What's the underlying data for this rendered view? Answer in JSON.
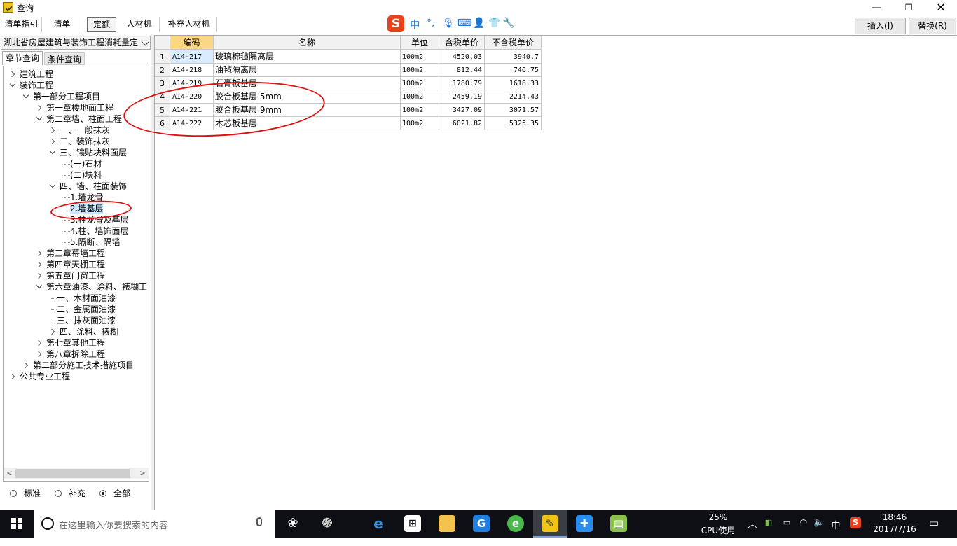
{
  "window": {
    "title": "查询"
  },
  "top_tabs": [
    "清单指引",
    "清单",
    "定额",
    "人材机",
    "补充人材机"
  ],
  "active_top_tab": "定额",
  "buttons": {
    "insert": "插入(I)",
    "replace": "替换(R)"
  },
  "ime": {
    "mode": "中",
    "punct": "°,"
  },
  "left_panel": {
    "dictionary": "湖北省房屋建筑与装饰工程消耗量定",
    "tabs": [
      "章节查询",
      "条件查询"
    ],
    "active_tab": "章节查询",
    "tree": [
      {
        "label": "建筑工程",
        "level": 0,
        "state": "collapsed"
      },
      {
        "label": "装饰工程",
        "level": 0,
        "state": "expanded"
      },
      {
        "label": "第一部分工程项目",
        "level": 1,
        "state": "expanded"
      },
      {
        "label": "第一章楼地面工程",
        "level": 2,
        "state": "collapsed"
      },
      {
        "label": "第二章墙、柱面工程",
        "level": 2,
        "state": "expanded"
      },
      {
        "label": "一、一般抹灰",
        "level": 3,
        "state": "collapsed"
      },
      {
        "label": "二、装饰抹灰",
        "level": 3,
        "state": "collapsed"
      },
      {
        "label": "三、镶贴块料面层",
        "level": 3,
        "state": "expanded"
      },
      {
        "label": "(一)石材",
        "level": 4,
        "state": "leaf"
      },
      {
        "label": "(二)块料",
        "level": 4,
        "state": "leaf"
      },
      {
        "label": "四、墙、柱面装饰",
        "level": 3,
        "state": "expanded"
      },
      {
        "label": "1.墙龙骨",
        "level": 4,
        "state": "leaf"
      },
      {
        "label": "2.墙基层",
        "level": 4,
        "state": "leaf",
        "selected": true
      },
      {
        "label": "3.柱龙骨及基层",
        "level": 4,
        "state": "leaf"
      },
      {
        "label": "4.柱、墙饰面层",
        "level": 4,
        "state": "leaf"
      },
      {
        "label": "5.隔断、隔墙",
        "level": 4,
        "state": "leaf"
      },
      {
        "label": "第三章幕墙工程",
        "level": 2,
        "state": "collapsed"
      },
      {
        "label": "第四章天棚工程",
        "level": 2,
        "state": "collapsed"
      },
      {
        "label": "第五章门窗工程",
        "level": 2,
        "state": "collapsed"
      },
      {
        "label": "第六章油漆、涂料、裱糊工",
        "level": 2,
        "state": "expanded"
      },
      {
        "label": "一、木材面油漆",
        "level": 3,
        "state": "leaf"
      },
      {
        "label": "二、金属面油漆",
        "level": 3,
        "state": "leaf"
      },
      {
        "label": "三、抹灰面油漆",
        "level": 3,
        "state": "leaf"
      },
      {
        "label": "四、涂料、裱糊",
        "level": 3,
        "state": "collapsed"
      },
      {
        "label": "第七章其他工程",
        "level": 2,
        "state": "collapsed"
      },
      {
        "label": "第八章拆除工程",
        "level": 2,
        "state": "collapsed"
      },
      {
        "label": "第二部分施工技术措施项目",
        "level": 1,
        "state": "collapsed"
      },
      {
        "label": "公共专业工程",
        "level": 0,
        "state": "collapsed"
      }
    ],
    "filters": [
      "标准",
      "补充",
      "全部"
    ],
    "active_filter": "全部"
  },
  "grid": {
    "columns": [
      "编码",
      "名称",
      "单位",
      "含税单价",
      "不含税单价"
    ],
    "rows": [
      {
        "no": "1",
        "code": "A14-217",
        "name": "玻璃棉毡隔离层",
        "unit": "100m2",
        "price_tax": "4520.03",
        "price_notax": "3940.7"
      },
      {
        "no": "2",
        "code": "A14-218",
        "name": "油毡隔离层",
        "unit": "100m2",
        "price_tax": "812.44",
        "price_notax": "746.75"
      },
      {
        "no": "3",
        "code": "A14-219",
        "name": "石膏板基层",
        "unit": "100m2",
        "price_tax": "1780.79",
        "price_notax": "1618.33"
      },
      {
        "no": "4",
        "code": "A14-220",
        "name": "胶合板基层 5mm",
        "unit": "100m2",
        "price_tax": "2459.19",
        "price_notax": "2214.43"
      },
      {
        "no": "5",
        "code": "A14-221",
        "name": "胶合板基层 9mm",
        "unit": "100m2",
        "price_tax": "3427.09",
        "price_notax": "3071.57"
      },
      {
        "no": "6",
        "code": "A14-222",
        "name": "木芯板基层",
        "unit": "100m2",
        "price_tax": "6021.82",
        "price_notax": "5325.35"
      }
    ]
  },
  "taskbar": {
    "search_placeholder": "在这里输入你要搜索的内容",
    "apps": [
      "task-view",
      "sogou-explorer",
      "edge",
      "store",
      "file-explorer",
      "sogou-browser",
      "360-browser",
      "pricing-software",
      "app-plus",
      "notes"
    ],
    "cpu_percent": "25%",
    "cpu_label": "CPU使用",
    "ime_indicator": "中",
    "time": "18:46",
    "date": "2017/7/16"
  },
  "colors": {
    "selected_header": "#fbd784",
    "selection": "#cce8ff",
    "annotation": "#e01010",
    "taskbar": "#0d0f14"
  }
}
